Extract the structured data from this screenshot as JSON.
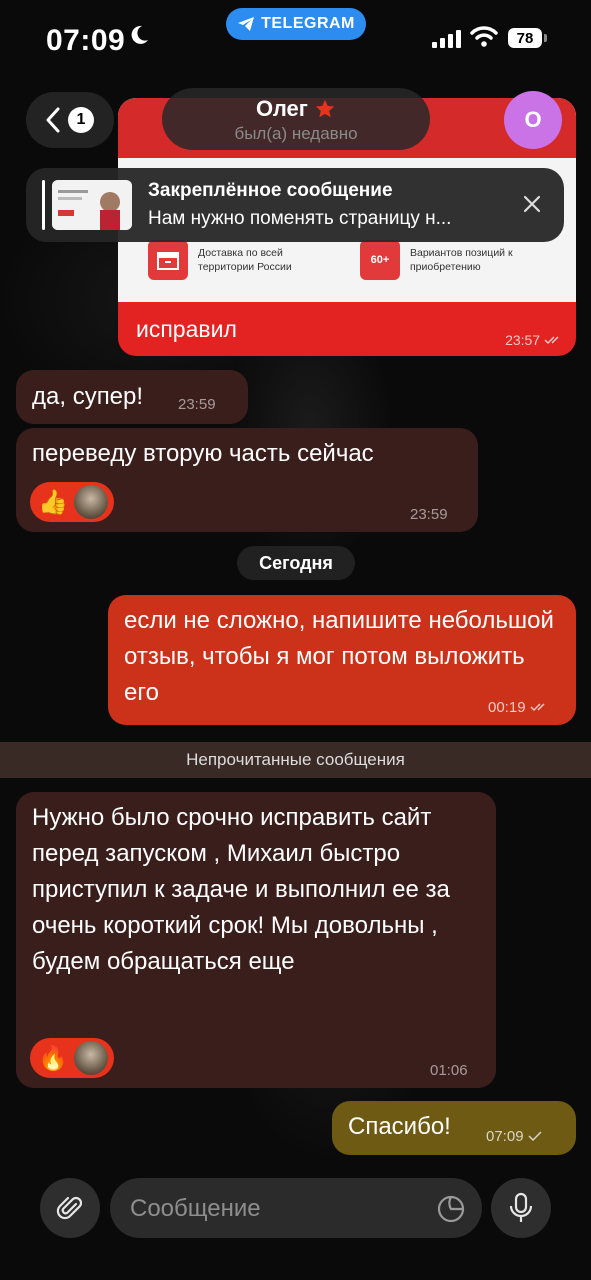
{
  "status_bar": {
    "time": "07:09",
    "app_pill": "TELEGRAM",
    "battery": "78"
  },
  "header": {
    "back_count": "1",
    "contact_name": "Олег",
    "contact_status": "был(а) недавно",
    "avatar_initial": "О"
  },
  "pinned": {
    "title": "Закреплённое сообщение",
    "text": "Нам нужно поменять страницу н..."
  },
  "image_message": {
    "features": [
      {
        "icon": "box-icon",
        "icon_text": "",
        "text": "Доставка по всей территории России"
      },
      {
        "icon": "badge",
        "icon_text": "60+",
        "text": "Вариантов позиций к приобретению"
      }
    ],
    "caption": "исправил",
    "time": "23:57"
  },
  "messages": [
    {
      "dir": "in",
      "text": "да, супер!",
      "time": "23:59"
    },
    {
      "dir": "in",
      "text": "переведу вторую часть сейчас",
      "time": "23:59",
      "reaction": "👍"
    },
    {
      "dir": "date",
      "text": "Сегодня"
    },
    {
      "dir": "out",
      "text": "если не сложно, напишите небольшой отзыв, чтобы я мог потом выложить его",
      "time": "00:19"
    },
    {
      "dir": "unread",
      "text": "Непрочитанные сообщения"
    },
    {
      "dir": "in",
      "text": "Нужно было срочно исправить сайт перед запуском , Михаил быстро приступил к задаче и выполнил ее за очень короткий срок! Мы довольны , будем обращаться еще",
      "time": "01:06",
      "reaction": "🔥"
    },
    {
      "dir": "out",
      "text": "Спасибо!",
      "time": "07:09"
    }
  ],
  "input": {
    "placeholder": "Сообщение"
  },
  "colors": {
    "accent": "#2d8cf0",
    "outgoing": "#cc321a",
    "incoming": "#3a1e1c",
    "avatar": "#c973e6"
  }
}
